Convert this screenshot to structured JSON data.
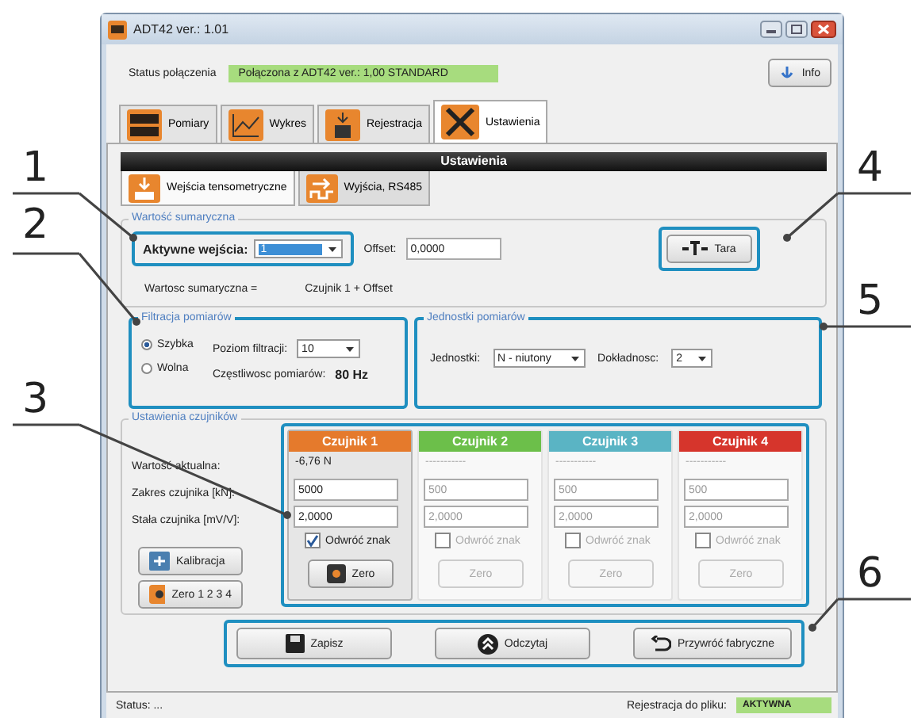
{
  "window": {
    "title": "ADT42  ver.: 1.01"
  },
  "connection": {
    "label": "Status połączenia",
    "value": "Połączona z ADT42 ver.: 1,00 STANDARD"
  },
  "info_button": "Info",
  "tabs": [
    {
      "label": "Pomiary",
      "kind": "display",
      "selected": false
    },
    {
      "label": "Wykres",
      "kind": "chart",
      "selected": false
    },
    {
      "label": "Rejestracja",
      "kind": "record",
      "selected": false
    },
    {
      "label": "Ustawienia",
      "kind": "tools",
      "selected": true
    }
  ],
  "panel_title": "Ustawienia",
  "subtabs": [
    {
      "label": "Wejścia tensometryczne",
      "kind": "input",
      "selected": true
    },
    {
      "label": "Wyjścia, RS485",
      "kind": "output",
      "selected": false
    }
  ],
  "sum": {
    "legend": "Wartość sumaryczna",
    "active_label": "Aktywne wejścia:",
    "active_value": "1",
    "offset_label": "Offset:",
    "offset_value": "0,0000",
    "tara_button": "Tara",
    "formula_label": "Wartosc sumaryczna =",
    "formula": "Czujnik 1 + Offset"
  },
  "filter": {
    "legend": "Filtracja pomiarów",
    "modes": [
      {
        "label": "Szybka",
        "selected": true
      },
      {
        "label": "Wolna",
        "selected": false
      }
    ],
    "level_label": "Poziom filtracji:",
    "level_value": "10",
    "freq_label": "Częstliwosc pomiarów:",
    "freq_value": "80 Hz"
  },
  "units": {
    "legend": "Jednostki pomiarów",
    "unit_label": "Jednostki:",
    "unit_value": "N - niutony",
    "precision_label": "Dokładnosc:",
    "precision_value": "2"
  },
  "sensors": {
    "legend": "Ustawienia czujników",
    "row_labels": [
      "Wartość aktualna:",
      "Zakres czujnika [kN]:",
      "Stała czujnika [mV/V]:"
    ],
    "calibrate_button": "Kalibracja",
    "zero_all_button": "Zero 1 2 3 4",
    "columns": [
      {
        "title": "Czujnik 1",
        "color": "#e57a2c",
        "disabled": false,
        "value": "-6,76 N",
        "range": "5000",
        "constant": "2,0000",
        "invert_label": "Odwróć znak",
        "inverted": true,
        "zero_button": "Zero"
      },
      {
        "title": "Czujnik 2",
        "color": "#6cbf4a",
        "disabled": true,
        "value": "-----------",
        "range": "500",
        "constant": "2,0000",
        "invert_label": "Odwróć znak",
        "inverted": false,
        "zero_button": "Zero"
      },
      {
        "title": "Czujnik 3",
        "color": "#5ab4c4",
        "disabled": true,
        "value": "-----------",
        "range": "500",
        "constant": "2,0000",
        "invert_label": "Odwróć znak",
        "inverted": false,
        "zero_button": "Zero"
      },
      {
        "title": "Czujnik 4",
        "color": "#d6352c",
        "disabled": true,
        "value": "-----------",
        "range": "500",
        "constant": "2,0000",
        "invert_label": "Odwróć znak",
        "inverted": false,
        "zero_button": "Zero"
      }
    ]
  },
  "buttons": [
    {
      "label": "Zapisz",
      "kind": "save"
    },
    {
      "label": "Odczytaj",
      "kind": "read"
    },
    {
      "label": "Przywróć fabryczne",
      "kind": "restore"
    }
  ],
  "status_bar": {
    "status": "Status: ...",
    "logging_label": "Rejestracja do pliku:",
    "logging_value": "AKTYWNA"
  },
  "callouts": [
    {
      "number": "1"
    },
    {
      "number": "2"
    },
    {
      "number": "3"
    },
    {
      "number": "4"
    },
    {
      "number": "5"
    },
    {
      "number": "6"
    }
  ]
}
